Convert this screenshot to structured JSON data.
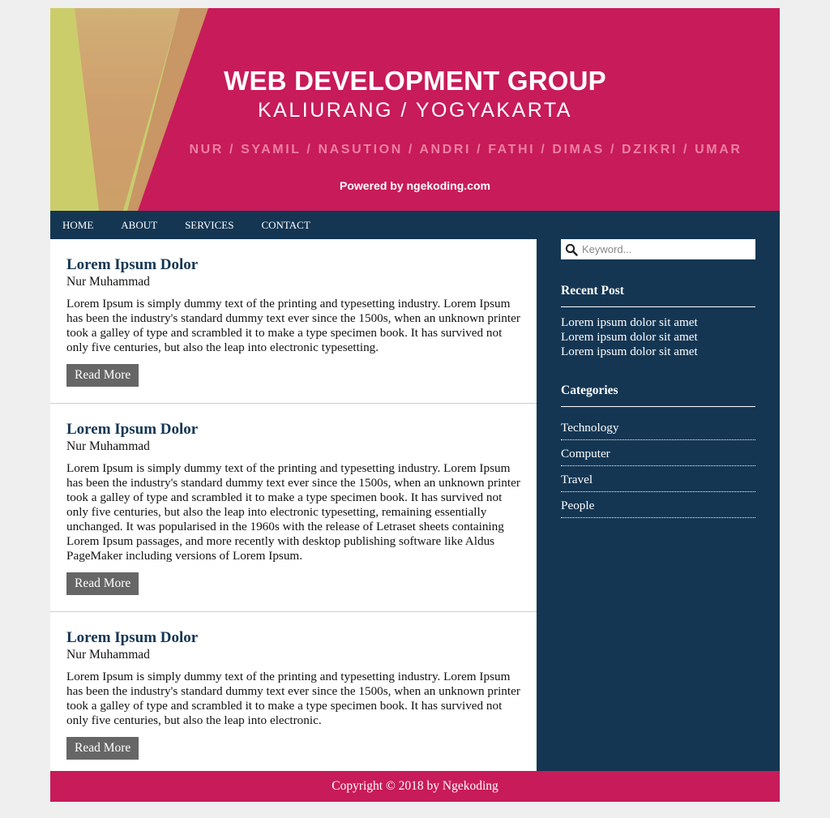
{
  "header": {
    "title": "WEB DEVELOPMENT GROUP",
    "subtitle": "KALIURANG / YOGYAKARTA",
    "members": "NUR / SYAMIL / NASUTION / ANDRI / FATHI / DIMAS / DZIKRI / UMAR",
    "powered": "Powered by ngekoding.com",
    "colors": {
      "primary": "#c81b59",
      "accent": "#c5cf6a",
      "nav": "#143653"
    }
  },
  "nav": {
    "items": [
      "HOME",
      "ABOUT",
      "SERVICES",
      "CONTACT"
    ]
  },
  "posts": [
    {
      "title": "Lorem Ipsum Dolor",
      "author": "Nur Muhammad",
      "body": "Lorem Ipsum is simply dummy text of the printing and typesetting industry. Lorem Ipsum has been the industry's standard dummy text ever since the 1500s, when an unknown printer took a galley of type and scrambled it to make a type specimen book. It has survived not only five centuries, but also the leap into electronic typesetting.",
      "button": "Read More"
    },
    {
      "title": "Lorem Ipsum Dolor",
      "author": "Nur Muhammad",
      "body": "Lorem Ipsum is simply dummy text of the printing and typesetting industry. Lorem Ipsum has been the industry's standard dummy text ever since the 1500s, when an unknown printer took a galley of type and scrambled it to make a type specimen book. It has survived not only five centuries, but also the leap into electronic typesetting, remaining essentially unchanged. It was popularised in the 1960s with the release of Letraset sheets containing Lorem Ipsum passages, and more recently with desktop publishing software like Aldus PageMaker including versions of Lorem Ipsum.",
      "button": "Read More"
    },
    {
      "title": "Lorem Ipsum Dolor",
      "author": "Nur Muhammad",
      "body": "Lorem Ipsum is simply dummy text of the printing and typesetting industry. Lorem Ipsum has been the industry's standard dummy text ever since the 1500s, when an unknown printer took a galley of type and scrambled it to make a type specimen book. It has survived not only five centuries, but also the leap into electronic.",
      "button": "Read More"
    }
  ],
  "sidebar": {
    "search_placeholder": "Keyword...",
    "search_icon": "search-icon",
    "recent_title": "Recent Post",
    "recent": [
      "Lorem ipsum dolor sit amet",
      "Lorem ipsum dolor sit amet",
      "Lorem ipsum dolor sit amet"
    ],
    "categories_title": "Categories",
    "categories": [
      "Technology",
      "Computer",
      "Travel",
      "People"
    ]
  },
  "footer": {
    "text": "Copyright © 2018 by Ngekoding"
  }
}
